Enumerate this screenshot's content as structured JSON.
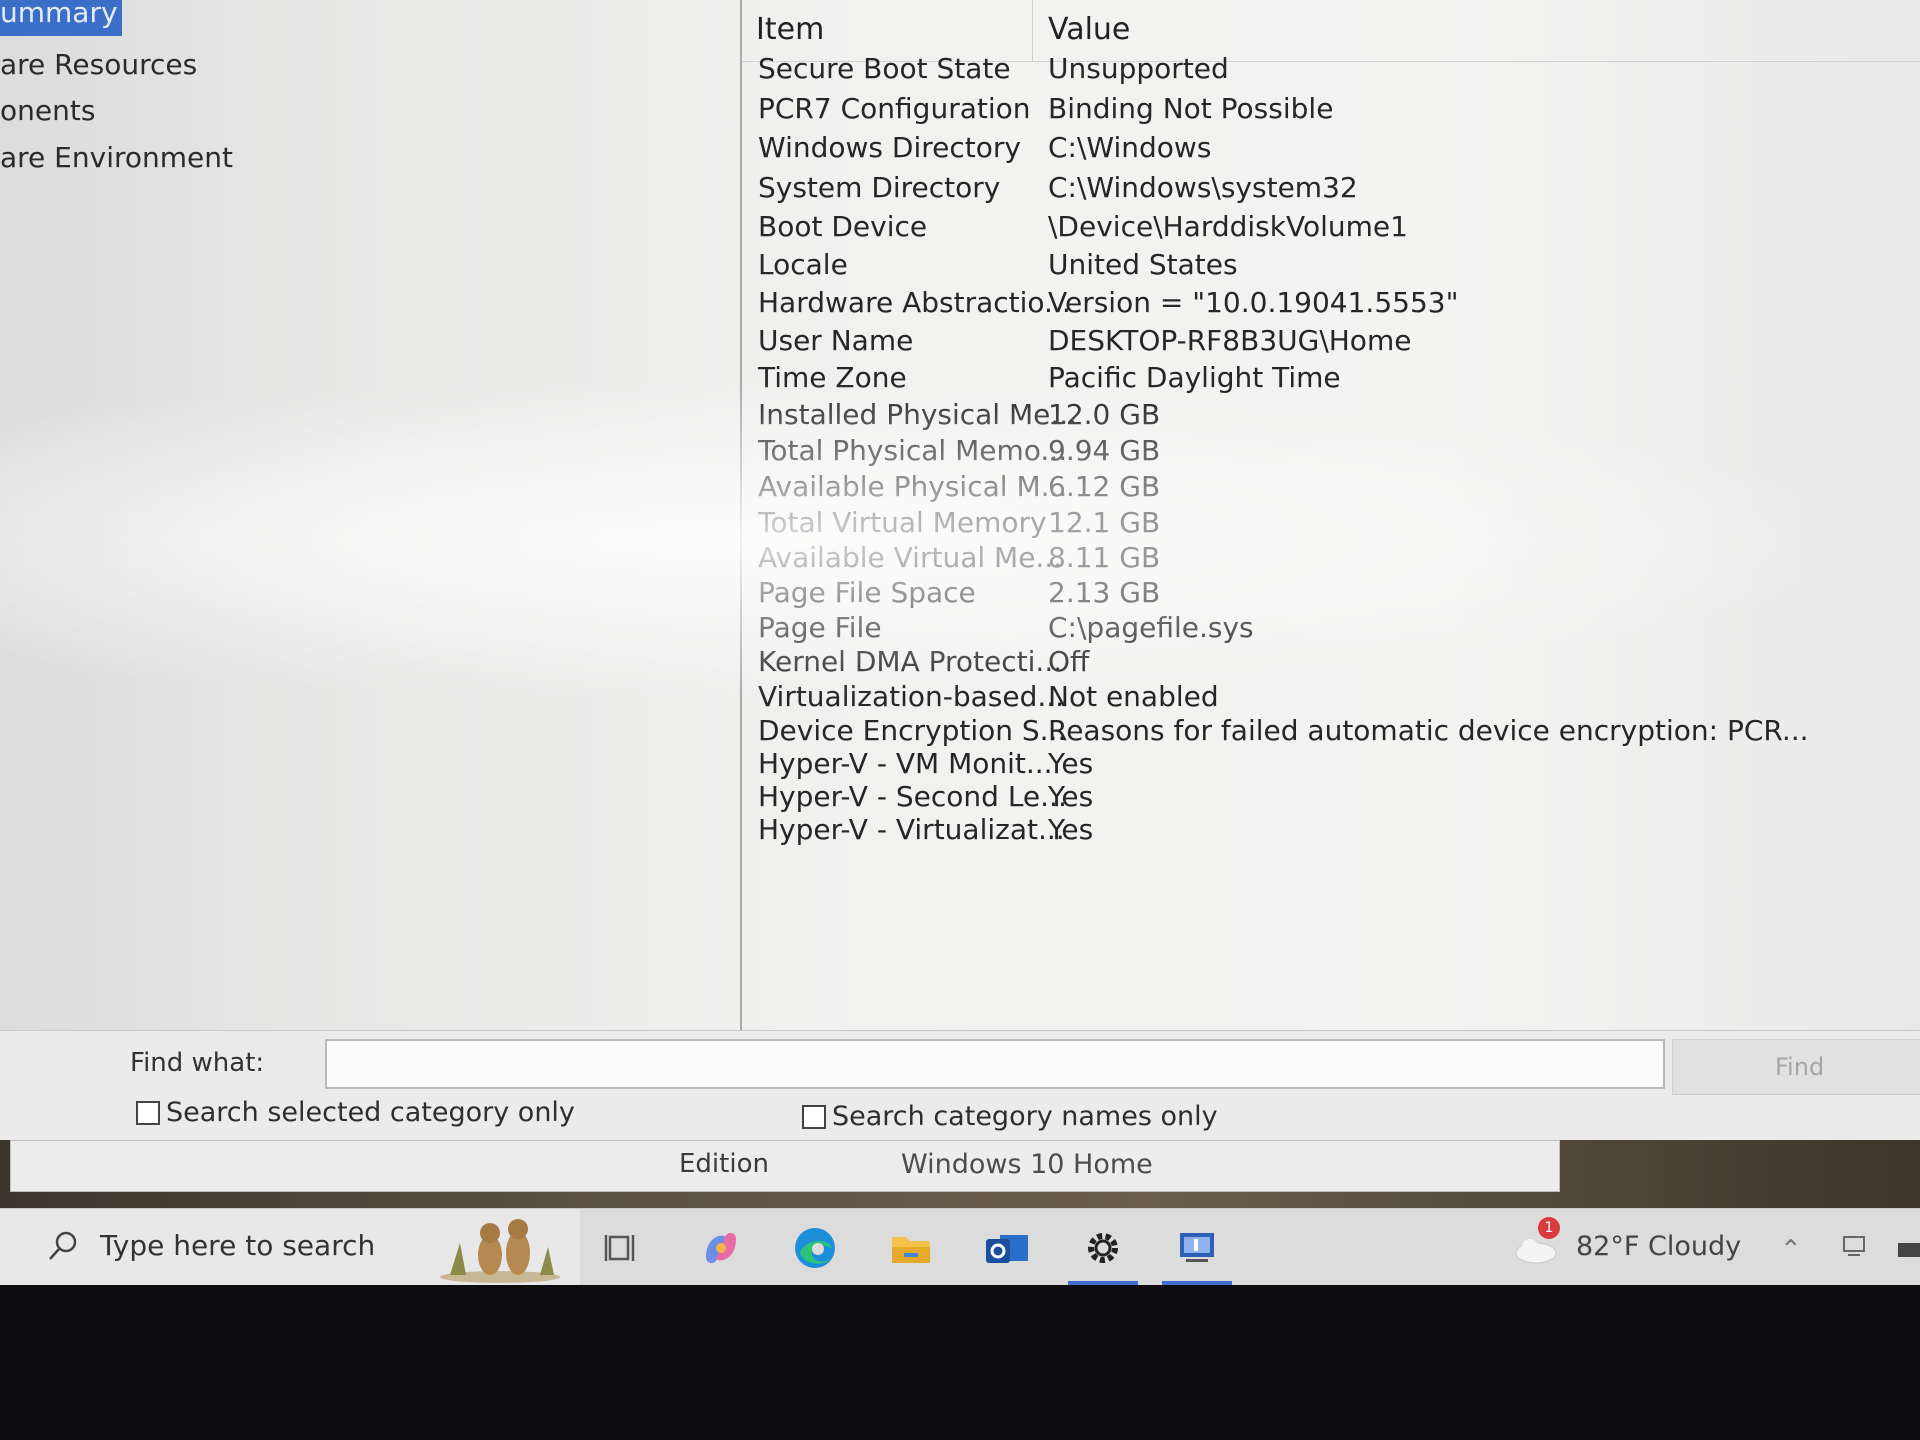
{
  "tree": {
    "items": [
      {
        "label": "ummary",
        "selected": true
      },
      {
        "label": "are Resources"
      },
      {
        "label": "onents"
      },
      {
        "label": "are Environment"
      }
    ]
  },
  "details": {
    "header": {
      "item": "Item",
      "value": "Value"
    },
    "rows": [
      {
        "item": "Secure Boot State",
        "value": "Unsupported"
      },
      {
        "item": "PCR7 Configuration",
        "value": "Binding Not Possible"
      },
      {
        "item": "Windows Directory",
        "value": "C:\\Windows"
      },
      {
        "item": "System Directory",
        "value": "C:\\Windows\\system32"
      },
      {
        "item": "Boot Device",
        "value": "\\Device\\HarddiskVolume1"
      },
      {
        "item": "Locale",
        "value": "United States"
      },
      {
        "item": "Hardware Abstractio...",
        "value": "Version = \"10.0.19041.5553\""
      },
      {
        "item": "User Name",
        "value": "DESKTOP-RF8B3UG\\Home"
      },
      {
        "item": "Time Zone",
        "value": "Pacific Daylight Time"
      },
      {
        "item": "Installed Physical Me...",
        "value": "12.0 GB"
      },
      {
        "item": "Total Physical Memo...",
        "value": "9.94 GB"
      },
      {
        "item": "Available Physical M...",
        "value": "6.12 GB"
      },
      {
        "item": "Total Virtual Memory",
        "value": "12.1 GB"
      },
      {
        "item": "Available Virtual Me...",
        "value": "8.11 GB"
      },
      {
        "item": "Page File Space",
        "value": "2.13 GB"
      },
      {
        "item": "Page File",
        "value": "C:\\pagefile.sys"
      },
      {
        "item": "Kernel DMA Protecti...",
        "value": "Off"
      },
      {
        "item": "Virtualization-based...",
        "value": "Not enabled"
      },
      {
        "item": "Device Encryption S...",
        "value": "Reasons for failed automatic device encryption: PCR..."
      },
      {
        "item": "Hyper-V - VM Monit...",
        "value": "Yes"
      },
      {
        "item": "Hyper-V - Second Le...",
        "value": "Yes"
      },
      {
        "item": "Hyper-V - Virtualizat...",
        "value": "Yes"
      }
    ]
  },
  "find": {
    "label": "Find what:",
    "value": "",
    "button": "Find",
    "option_selected_only": "Search selected category only",
    "option_names_only": "Search category names only"
  },
  "edition": {
    "label": "Edition",
    "value": "Windows 10 Home"
  },
  "taskbar": {
    "search_placeholder": "Type here to search",
    "weather_badge": "1",
    "weather": "82°F  Cloudy",
    "apps": [
      "task-view-icon",
      "copilot-icon",
      "edge-icon",
      "file-explorer-icon",
      "outlook-icon",
      "settings-icon",
      "system-information-icon"
    ]
  }
}
